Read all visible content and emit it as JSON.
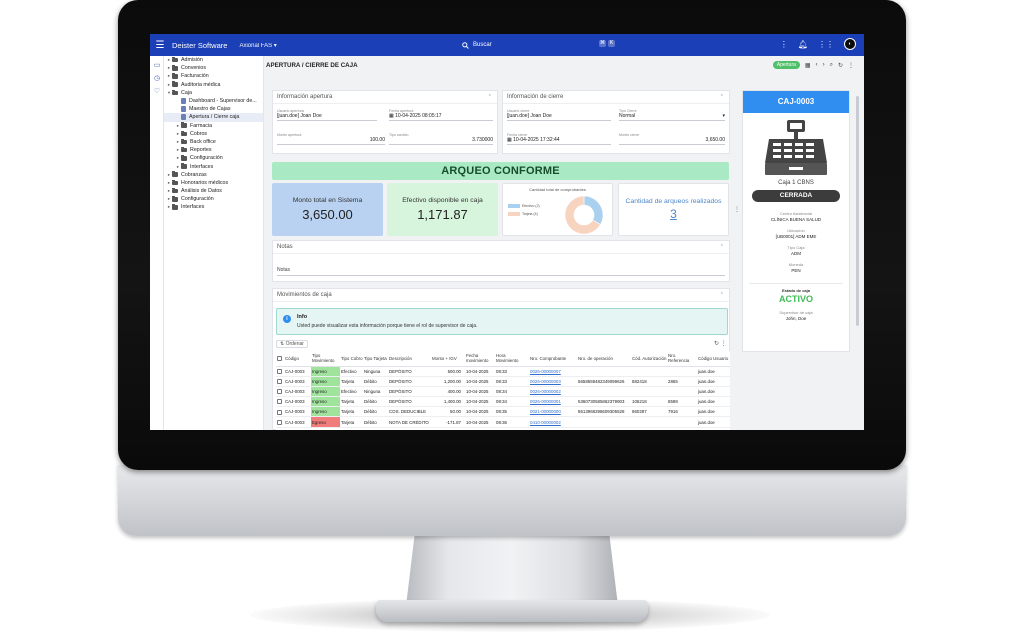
{
  "topbar": {
    "brand": "Deister Software",
    "company": "Axional FAS ▾",
    "search_placeholder": "Buscar"
  },
  "tree": [
    {
      "label": "Admisión",
      "indent": 0,
      "expanded": false
    },
    {
      "label": "Convenios",
      "indent": 0,
      "expanded": false
    },
    {
      "label": "Facturación",
      "indent": 0,
      "expanded": false
    },
    {
      "label": "Auditoria médica",
      "indent": 0,
      "expanded": false
    },
    {
      "label": "Caja",
      "indent": 0,
      "expanded": true
    },
    {
      "label": "Dashboard - Supervisor de...",
      "indent": 1,
      "doc": true
    },
    {
      "label": "Maestro de Cajas",
      "indent": 1,
      "doc": true
    },
    {
      "label": "Apertura / Cierre caja",
      "indent": 1,
      "doc": true,
      "selected": true
    },
    {
      "label": "Farmacia",
      "indent": 1,
      "expanded": false
    },
    {
      "label": "Cobros",
      "indent": 1,
      "expanded": false
    },
    {
      "label": "Back office",
      "indent": 1,
      "expanded": false
    },
    {
      "label": "Reportes",
      "indent": 1,
      "expanded": false
    },
    {
      "label": "Configuración",
      "indent": 1,
      "expanded": false
    },
    {
      "label": "Interfaces",
      "indent": 1,
      "expanded": false
    },
    {
      "label": "Cobranzas",
      "indent": 0,
      "expanded": false
    },
    {
      "label": "Honorarios médicos",
      "indent": 0,
      "expanded": false
    },
    {
      "label": "Análisis de Datos",
      "indent": 0,
      "expanded": false
    },
    {
      "label": "Configuración",
      "indent": 0,
      "expanded": false
    },
    {
      "label": "Interfaces",
      "indent": 0,
      "expanded": false
    }
  ],
  "page": {
    "title": "APERTURA / CIERRE DE CAJA",
    "status_pill": "Apertura"
  },
  "apertura": {
    "title": "Información apertura",
    "usuario_label": "Usuario apertura",
    "usuario": "[juan.doe] Joan Doe",
    "fecha_label": "Fecha apertura",
    "fecha": "10-04-2025 08:05:17",
    "monto_label": "Monto apertura",
    "monto": "100.00",
    "tipo_label": "Tipo cambio",
    "tipo": "3.730000"
  },
  "cierre": {
    "title": "Información de cierre",
    "usuario_label": "Usuario cierre",
    "usuario": "[juan.doe] Joan Doe",
    "tipo_label": "Tipo Cierre",
    "tipo": "Normal",
    "fecha_label": "Fecha cierre",
    "fecha": "10-04-2025 17:32:44",
    "monto_label": "Monto cierre",
    "monto": "3,650.00"
  },
  "arqueo": "ARQUEO CONFORME",
  "cards": {
    "monto_title": "Monto total en Sistema",
    "monto_value": "3,650.00",
    "efectivo_title": "Efectivo disponible en caja",
    "efectivo_value": "1,171.87",
    "chart_title": "Cantidad total de comprobantes",
    "arqueos_title": "Cantidad de arqueos realizados",
    "arqueos_value": "3"
  },
  "chart_data": {
    "type": "pie",
    "title": "Cantidad total de comprobantes",
    "labels": [
      "Efectivo (2)",
      "Tarjeta (4)"
    ],
    "values": [
      2,
      4
    ],
    "colors": [
      "#a9d0ee",
      "#f7d4bf"
    ]
  },
  "notas": {
    "title": "Notas",
    "label": "Notas"
  },
  "movimientos": {
    "title": "Movimientos de caja",
    "info_title": "Info",
    "info_text": "Usted puede visualizar esta información porque tiene el rol de supervisor de caja.",
    "ordenar": "⇅ Ordenar",
    "columns": [
      "Código",
      "Tipo Movimiento",
      "Tipo Cobro",
      "Tipo Tarjeta",
      "Descripción",
      "Monto + IGV",
      "Fecha movimiento",
      "Hora Movimiento",
      "Nro. Comprobante",
      "Nro. de operación",
      "Cód. Autorización",
      "Nro. Referencia",
      "Código Usuario"
    ],
    "rows": [
      [
        "CAJ-0003",
        "Ingreso",
        "Efectivo",
        "Ninguna",
        "DEPÓSITO",
        "500.00",
        "10-04-2025",
        "08:33",
        "0026-00000007",
        "",
        "",
        "",
        "juan.doe"
      ],
      [
        "CAJ-0003",
        "Ingreso",
        "Tarjeta",
        "Débito",
        "DEPÓSITO",
        "1,200.00",
        "10-04-2025",
        "08:33",
        "0026-00000003",
        "5658559482349099626",
        "882418",
        "2865",
        "juan.doe"
      ],
      [
        "CAJ-0003",
        "Ingreso",
        "Efectivo",
        "Ninguna",
        "DEPÓSITO",
        "400.00",
        "10-04-2025",
        "08:34",
        "0026-00000002",
        "",
        "",
        "",
        "juan.doe"
      ],
      [
        "CAJ-0003",
        "Ingreso",
        "Tarjeta",
        "Débito",
        "DEPÓSITO",
        "1,400.00",
        "10-04-2025",
        "08:34",
        "0026-00000001",
        "5360730585862379903",
        "106218",
        "8598",
        "juan.doe"
      ],
      [
        "CAJ-0003",
        "Ingreso",
        "Tarjeta",
        "Débito",
        "COS. DEDUCIBLE",
        "50.00",
        "10-04-2025",
        "08:35",
        "0021-00000000",
        "8613968298609305528",
        "860287",
        "7916",
        "juan.doe"
      ],
      [
        "CAJ-0003",
        "Egreso",
        "Tarjeta",
        "Débito",
        "NOTA DE CRÉDITO",
        "-171.87",
        "10-04-2025",
        "08:36",
        "0410-00000002",
        "",
        "",
        "",
        "juan.doe"
      ]
    ]
  },
  "side": {
    "code": "CAJ-0003",
    "caja_name": "Caja 1 CBNS",
    "status": "CERRADA",
    "centro_label": "Centro Asistencial",
    "centro": "CLÍNICA BUENA SALUD",
    "ubicacion_label": "Ubicacion",
    "ubicacion": "[UB0001] ADM EME",
    "tipo_label": "Tipo Caja",
    "tipo": "ADM",
    "moneda_label": "Moneda",
    "moneda": "PEN",
    "estado_label": "Estado de caja",
    "estado": "ACTIVO",
    "supervisor_label": "Supervisor de caja",
    "supervisor": "John, Doe"
  }
}
